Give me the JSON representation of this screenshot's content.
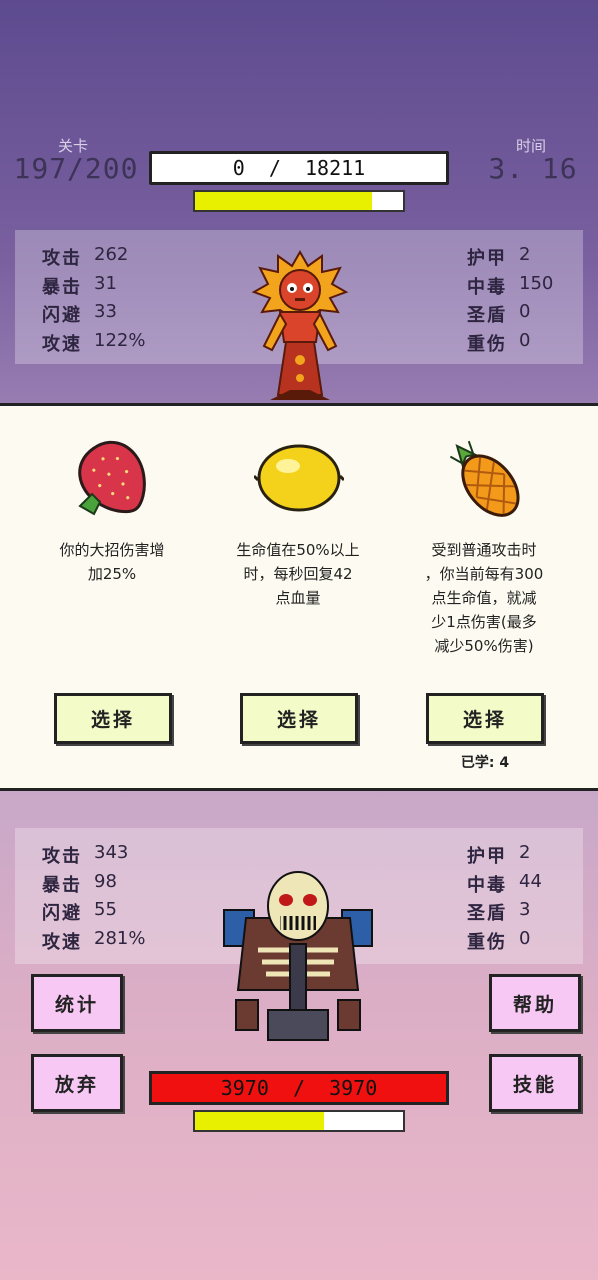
{
  "header": {
    "level_label": "关卡",
    "level_value": "197/200",
    "time_label": "时间",
    "time_value": "3. 16",
    "enemy_hp_text": "0  /  18211",
    "enemy_charge_fraction": 0.85
  },
  "enemy_stats": {
    "left": [
      {
        "label": "攻击",
        "value": "262"
      },
      {
        "label": "暴击",
        "value": "31"
      },
      {
        "label": "闪避",
        "value": "33"
      },
      {
        "label": "攻速",
        "value": "122%"
      }
    ],
    "right": [
      {
        "label": "护甲",
        "value": "2"
      },
      {
        "label": "中毒",
        "value": "150"
      },
      {
        "label": "圣盾",
        "value": "0"
      },
      {
        "label": "重伤",
        "value": "0"
      }
    ]
  },
  "choices": [
    {
      "icon": "strawberry-icon",
      "desc": "你的大招伤害增\n加25%",
      "button": "选择",
      "learned": ""
    },
    {
      "icon": "lemon-icon",
      "desc": "生命值在50%以上\n时，每秒回复42\n点血量",
      "button": "选择",
      "learned": ""
    },
    {
      "icon": "pineapple-icon",
      "desc": "受到普通攻击时\n，你当前每有300\n点生命值，就减\n少1点伤害(最多\n减少50%伤害)",
      "button": "选择",
      "learned": "已学: 4"
    }
  ],
  "player_stats": {
    "left": [
      {
        "label": "攻击",
        "value": "343"
      },
      {
        "label": "暴击",
        "value": "98"
      },
      {
        "label": "闪避",
        "value": "55"
      },
      {
        "label": "攻速",
        "value": "281%"
      }
    ],
    "right": [
      {
        "label": "护甲",
        "value": "2"
      },
      {
        "label": "中毒",
        "value": "44"
      },
      {
        "label": "圣盾",
        "value": "3"
      },
      {
        "label": "重伤",
        "value": "0"
      }
    ]
  },
  "player": {
    "hp_text": "3970  /  3970",
    "charge_fraction": 0.62
  },
  "buttons": {
    "stats": "统计",
    "help": "帮助",
    "give_up": "放弃",
    "skills": "技能"
  },
  "colors": {
    "hp_red": "#f01010",
    "charge_yellow": "#e8f000",
    "button_pink": "#f6c8f3",
    "choose_green": "#f3fbc9"
  }
}
